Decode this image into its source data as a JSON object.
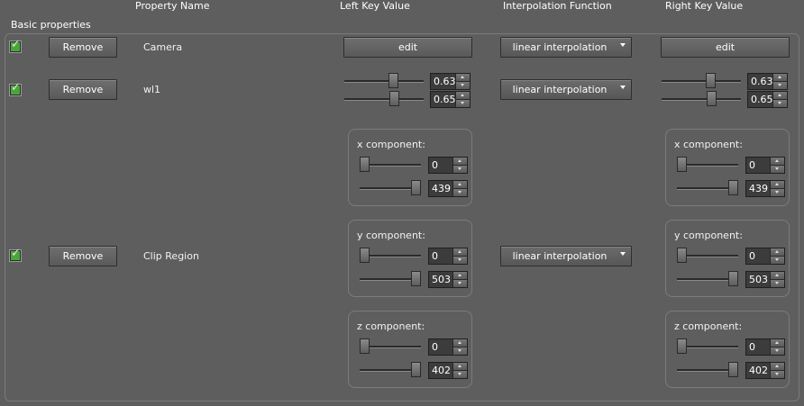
{
  "headers": {
    "property_name": "Property Name",
    "left_key_value": "Left Key Value",
    "interpolation_function": "Interpolation Function",
    "right_key_value": "Right Key Value"
  },
  "group": {
    "label": "Basic properties"
  },
  "rows": [
    {
      "name": "Camera",
      "checked": true,
      "remove_label": "Remove",
      "left_edit_label": "edit",
      "interpolation": "linear interpolation",
      "right_edit_label": "edit"
    },
    {
      "name": "wl1",
      "checked": true,
      "remove_label": "Remove",
      "interpolation": "linear interpolation",
      "left": {
        "value1": "0.63",
        "value2": "0.65",
        "fraction1": 0.63,
        "fraction2": 0.65
      },
      "right": {
        "value1": "0.63",
        "value2": "0.65",
        "fraction1": 0.63,
        "fraction2": 0.65
      }
    },
    {
      "name": "Clip Region",
      "checked": true,
      "remove_label": "Remove",
      "interpolation": "linear interpolation",
      "left": {
        "x": {
          "title": "x component:",
          "min": "0",
          "max": "439"
        },
        "y": {
          "title": "y component:",
          "min": "0",
          "max": "503"
        },
        "z": {
          "title": "z component:",
          "min": "0",
          "max": "402"
        }
      },
      "right": {
        "x": {
          "title": "x component:",
          "min": "0",
          "max": "439"
        },
        "y": {
          "title": "y component:",
          "min": "0",
          "max": "503"
        },
        "z": {
          "title": "z component:",
          "min": "0",
          "max": "402"
        }
      }
    }
  ],
  "colors": {
    "background": "#5e5e5e",
    "check_green": "#49a63a"
  }
}
